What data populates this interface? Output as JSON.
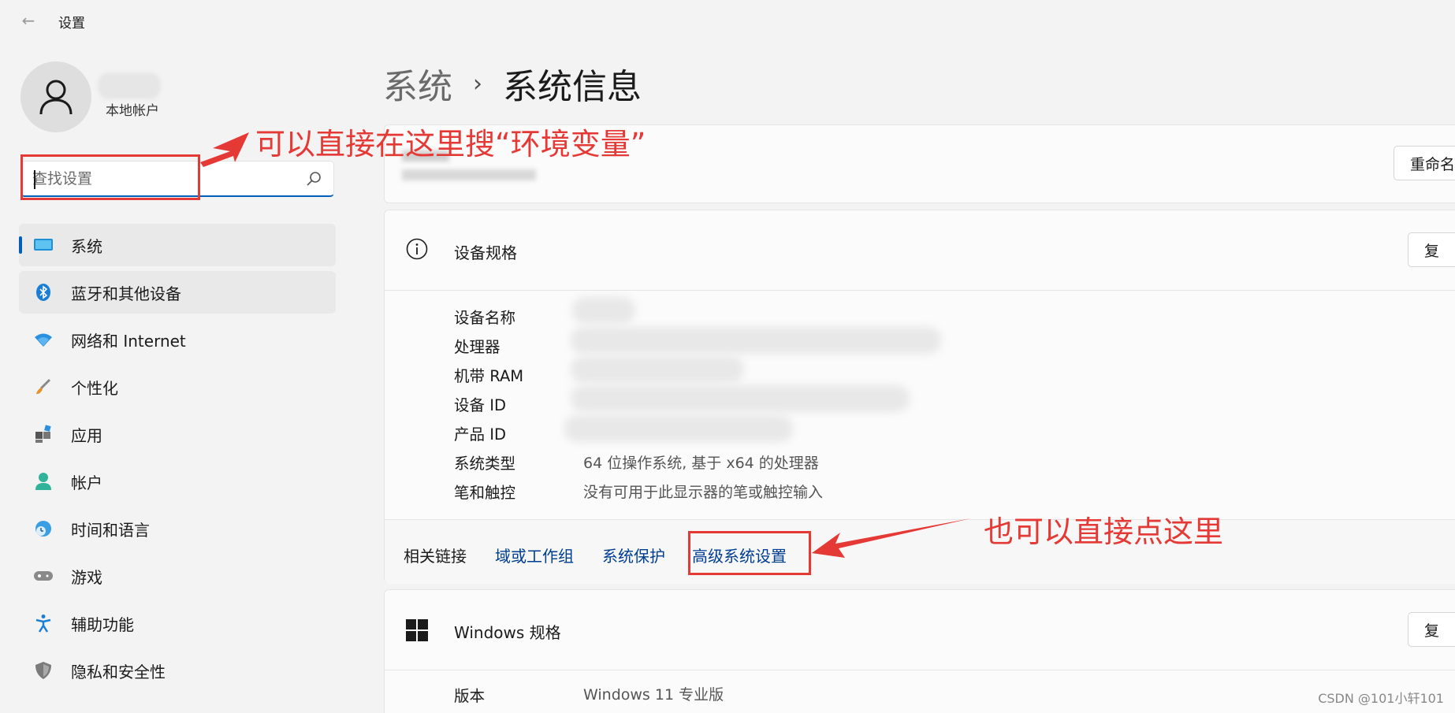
{
  "app": {
    "title": "设置"
  },
  "user": {
    "account_type": "本地帐户"
  },
  "search": {
    "placeholder": "查找设置"
  },
  "sidebar": {
    "items": [
      {
        "label": "系统",
        "icon": "monitor-icon"
      },
      {
        "label": "蓝牙和其他设备",
        "icon": "bluetooth-icon"
      },
      {
        "label": "网络和 Internet",
        "icon": "wifi-icon"
      },
      {
        "label": "个性化",
        "icon": "brush-icon"
      },
      {
        "label": "应用",
        "icon": "apps-icon"
      },
      {
        "label": "帐户",
        "icon": "person-icon"
      },
      {
        "label": "时间和语言",
        "icon": "globe-clock-icon"
      },
      {
        "label": "游戏",
        "icon": "gamepad-icon"
      },
      {
        "label": "辅助功能",
        "icon": "accessibility-icon"
      },
      {
        "label": "隐私和安全性",
        "icon": "shield-icon"
      }
    ]
  },
  "breadcrumb": {
    "parent": "系统",
    "separator": "›",
    "current": "系统信息"
  },
  "device_card": {
    "rename_button": "重命名"
  },
  "spec_card": {
    "title": "设备规格",
    "copy_button": "复",
    "rows": [
      {
        "label": "设备名称",
        "value": ""
      },
      {
        "label": "处理器",
        "value": ""
      },
      {
        "label": "机带 RAM",
        "value": ""
      },
      {
        "label": "设备 ID",
        "value": ""
      },
      {
        "label": "产品 ID",
        "value": ""
      },
      {
        "label": "系统类型",
        "value": "64 位操作系统, 基于 x64 的处理器"
      },
      {
        "label": "笔和触控",
        "value": "没有可用于此显示器的笔或触控输入"
      }
    ]
  },
  "related_links": {
    "label": "相关链接",
    "links": [
      "域或工作组",
      "系统保护",
      "高级系统设置"
    ]
  },
  "windows_card": {
    "title": "Windows 规格",
    "copy_button": "复",
    "rows": [
      {
        "label": "版本",
        "value": "Windows 11 专业版"
      }
    ]
  },
  "annotations": {
    "search_hint": "可以直接在这里搜“环境变量”",
    "link_hint": "也可以直接点这里"
  },
  "watermark": "CSDN @101小轩101",
  "colors": {
    "accent": "#005fb8",
    "link": "#003e92",
    "annotation": "#e53935"
  }
}
